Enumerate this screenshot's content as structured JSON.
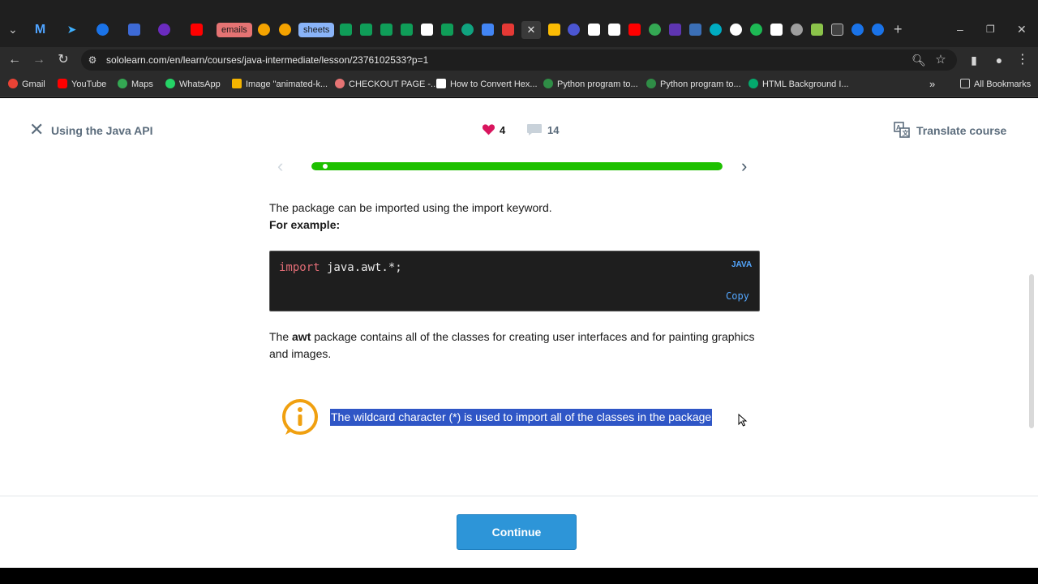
{
  "browser": {
    "tabs_labels": [
      "emails",
      "sheets"
    ],
    "url": "sololearn.com/en/learn/courses/java-intermediate/lesson/2376102533?p=1",
    "bookmarks": [
      {
        "label": "Gmail",
        "color": "#ea4335"
      },
      {
        "label": "YouTube",
        "color": "#ff0000"
      },
      {
        "label": "Maps",
        "color": "#34a853"
      },
      {
        "label": "WhatsApp",
        "color": "#25d366"
      },
      {
        "label": "Image \"animated-k...",
        "color": "#f4b400"
      },
      {
        "label": "CHECKOUT PAGE -...",
        "color": "#e57373"
      },
      {
        "label": "How to Convert Hex...",
        "color": "#ffffff"
      },
      {
        "label": "Python program to...",
        "color": "#2f8d46"
      },
      {
        "label": "Python program to...",
        "color": "#2f8d46"
      },
      {
        "label": "HTML Background I...",
        "color": "#04aa6d"
      }
    ],
    "all_bookmarks": "All Bookmarks"
  },
  "header": {
    "title": "Using the Java API",
    "likes": "4",
    "comments": "14",
    "translate": "Translate course"
  },
  "progress": {
    "fraction": 0.03
  },
  "lesson": {
    "intro": "The package can be imported using the import keyword.",
    "example_label": "For example:",
    "code_keyword": "import",
    "code_rest": " java.awt.*;",
    "code_lang": "JAVA",
    "copy_label": "Copy",
    "para_pre": "The ",
    "para_bold": "awt",
    "para_post": " package contains all of the classes for creating user interfaces and for painting graphics and images.",
    "info": "The wildcard character (*) is used to import all of the classes in the package"
  },
  "footer": {
    "continue": "Continue"
  },
  "colors": {
    "accent": "#2d95d8",
    "progress": "#1ec000",
    "heart": "#d9155e",
    "info": "#f0a010"
  }
}
